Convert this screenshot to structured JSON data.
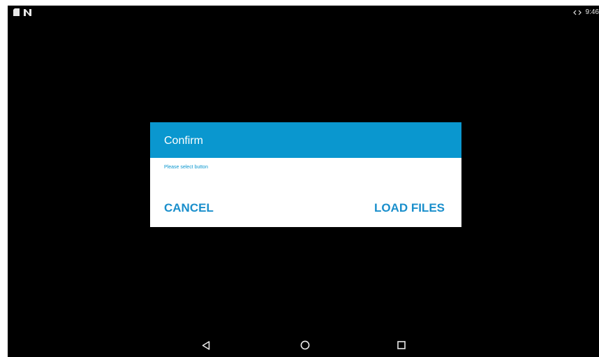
{
  "status_bar": {
    "left_icons": [
      "sd-card-icon",
      "n-notification-icon"
    ],
    "right_icons": [
      "data-transfer-icon"
    ],
    "time": "9:46"
  },
  "dialog": {
    "title": "Confirm",
    "message": "Please select button",
    "buttons": {
      "cancel": "CANCEL",
      "load_files": "LOAD FILES"
    },
    "colors": {
      "header_bg": "#0a97cf",
      "button_text": "#1a8fcc"
    }
  },
  "navigation_bar": {
    "buttons": [
      "back-icon",
      "home-icon",
      "recents-icon"
    ]
  }
}
